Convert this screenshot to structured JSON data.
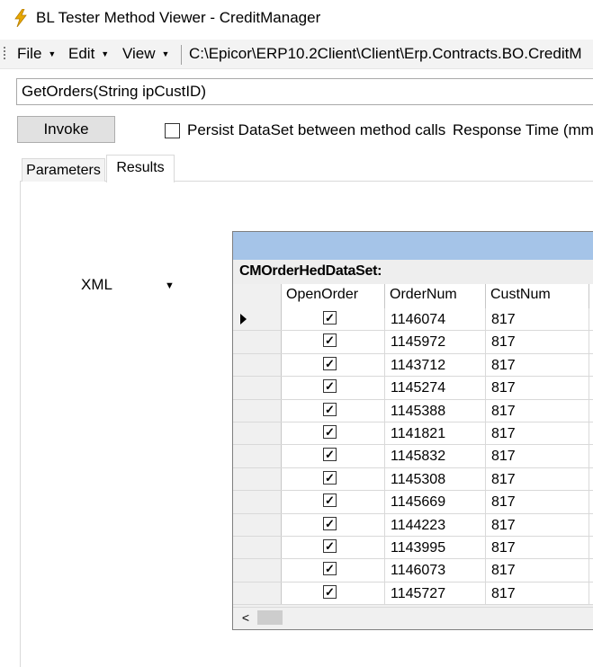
{
  "window": {
    "title": "BL Tester Method Viewer - CreditManager",
    "icon": "lightning-icon"
  },
  "toolbar": {
    "menus": [
      {
        "label": "File"
      },
      {
        "label": "Edit"
      },
      {
        "label": "View"
      }
    ],
    "path": "C:\\Epicor\\ERP10.2Client\\Client\\Erp.Contracts.BO.CreditM"
  },
  "method": {
    "signature": "GetOrders(String ipCustID)"
  },
  "actions": {
    "invoke_label": "Invoke",
    "persist_label": "Persist DataSet between method calls",
    "persist_checked": false,
    "response_label": "Response Time (mm:"
  },
  "tabs": [
    {
      "label": "Parameters",
      "active": false
    },
    {
      "label": "Results",
      "active": true
    }
  ],
  "results": {
    "format": "XML",
    "dataset_name": "CMOrderHedDataSet:",
    "columns": [
      "OpenOrder",
      "OrderNum",
      "CustNum"
    ],
    "rows": [
      {
        "open": true,
        "order": "1146074",
        "cust": "817",
        "selected": true
      },
      {
        "open": true,
        "order": "1145972",
        "cust": "817"
      },
      {
        "open": true,
        "order": "1143712",
        "cust": "817"
      },
      {
        "open": true,
        "order": "1145274",
        "cust": "817"
      },
      {
        "open": true,
        "order": "1145388",
        "cust": "817"
      },
      {
        "open": true,
        "order": "1141821",
        "cust": "817"
      },
      {
        "open": true,
        "order": "1145832",
        "cust": "817"
      },
      {
        "open": true,
        "order": "1145308",
        "cust": "817"
      },
      {
        "open": true,
        "order": "1145669",
        "cust": "817"
      },
      {
        "open": true,
        "order": "1144223",
        "cust": "817"
      },
      {
        "open": true,
        "order": "1143995",
        "cust": "817"
      },
      {
        "open": true,
        "order": "1146073",
        "cust": "817"
      },
      {
        "open": true,
        "order": "1145727",
        "cust": "817"
      }
    ]
  },
  "colors": {
    "grid_caption": "#a5c4e8",
    "button_face": "#e1e1e1"
  }
}
